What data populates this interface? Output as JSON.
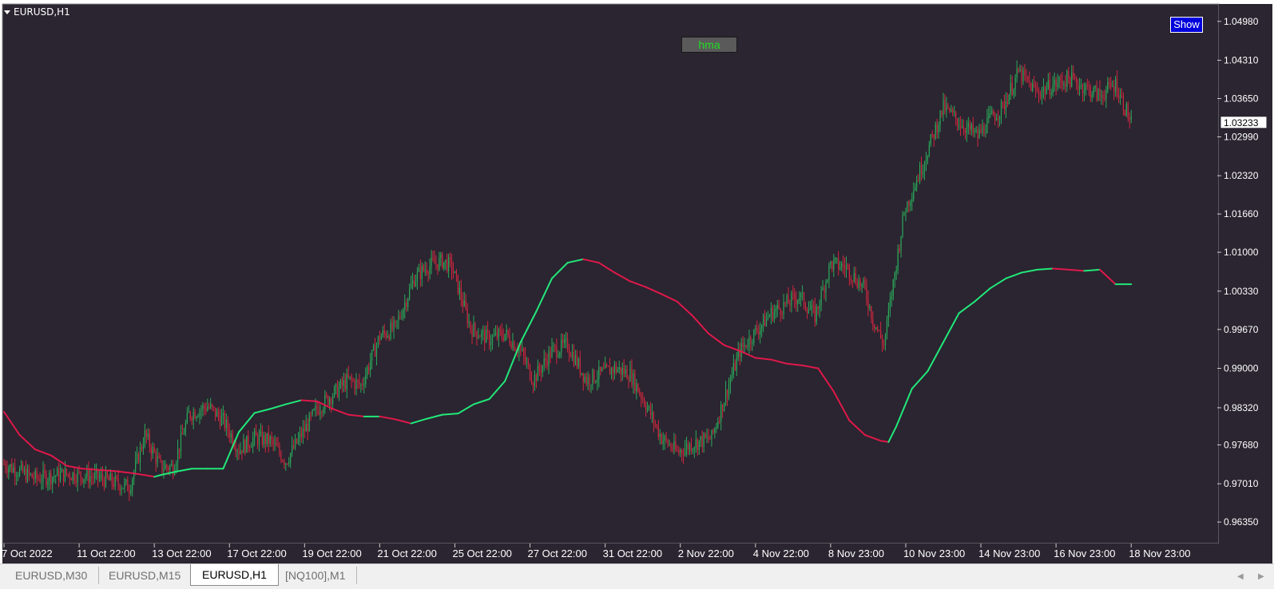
{
  "window": {
    "symbol_title": "EURUSD,H1",
    "hma_label": "hma",
    "show_button": "Show",
    "current_price": "1.03233"
  },
  "colors": {
    "background": "#2a2530",
    "bull_candle": "#2aa85a",
    "bear_candle": "#d0263f",
    "hma_up": "#22e87a",
    "hma_down": "#e0184a",
    "axis_text": "#ffffff",
    "hma_label_text": "#22dd22",
    "show_button_bg": "#0000dd"
  },
  "tabs": [
    {
      "label": "EURUSD,M30",
      "active": false
    },
    {
      "label": "EURUSD,M15",
      "active": false
    },
    {
      "label": "EURUSD,H1",
      "active": true
    },
    {
      "label": "[NQ100],M1",
      "active": false
    }
  ],
  "chart_data": {
    "type": "line",
    "title": "EURUSD,H1",
    "xlabel": "",
    "ylabel": "",
    "ylim": [
      0.9598,
      1.0528
    ],
    "y_ticks": [
      "1.04980",
      "1.04310",
      "1.03650",
      "1.02990",
      "1.02320",
      "1.01660",
      "1.01000",
      "1.00330",
      "0.99670",
      "0.99000",
      "0.98320",
      "0.97680",
      "0.97010",
      "0.96350"
    ],
    "x_ticks": [
      "7 Oct 2022",
      "11 Oct 22:00",
      "13 Oct 22:00",
      "17 Oct 22:00",
      "19 Oct 22:00",
      "21 Oct 22:00",
      "25 Oct 22:00",
      "27 Oct 22:00",
      "31 Oct 22:00",
      "2 Nov 22:00",
      "4 Nov 22:00",
      "8 Nov 23:00",
      "10 Nov 23:00",
      "14 Nov 23:00",
      "16 Nov 23:00",
      "18 Nov 23:00"
    ],
    "x_tick_positions": [
      0,
      48,
      96,
      144,
      192,
      240,
      288,
      336,
      384,
      432,
      480,
      528,
      576,
      624,
      672,
      720
    ],
    "x_range": [
      0,
      760
    ],
    "price_path": {
      "x": [
        0,
        20,
        40,
        60,
        80,
        90,
        100,
        108,
        118,
        130,
        140,
        150,
        160,
        170,
        180,
        200,
        220,
        228,
        240,
        250,
        262,
        270,
        280,
        286,
        298,
        310,
        320,
        330,
        338,
        350,
        360,
        372,
        390,
        400,
        410,
        420,
        430,
        440,
        452,
        470,
        490,
        508,
        518,
        528,
        538,
        550,
        555,
        562,
        575,
        588,
        600,
        612,
        622,
        630,
        638,
        648,
        660,
        680,
        700,
        710,
        720
      ],
      "y": [
        0.9735,
        0.971,
        0.9718,
        0.9712,
        0.9695,
        0.9785,
        0.973,
        0.973,
        0.982,
        0.9835,
        0.981,
        0.976,
        0.978,
        0.9775,
        0.974,
        0.983,
        0.988,
        0.987,
        0.9955,
        0.997,
        1.0055,
        1.0075,
        1.0085,
        1.0075,
        0.997,
        0.995,
        0.996,
        0.993,
        0.988,
        0.993,
        0.994,
        0.988,
        0.99,
        0.989,
        0.9838,
        0.978,
        0.9755,
        0.977,
        0.978,
        0.993,
        0.9995,
        1.0025,
        0.999,
        1.008,
        1.0075,
        1.0035,
        0.9985,
        0.994,
        1.017,
        1.026,
        1.035,
        1.032,
        1.03,
        1.033,
        1.035,
        1.041,
        1.0375,
        1.04,
        1.037,
        1.039,
        1.0323
      ]
    },
    "series": [
      {
        "x": [
          0,
          10,
          20,
          30,
          40,
          50,
          60,
          70,
          80,
          90,
          96,
          100,
          110,
          120,
          130,
          140,
          150,
          160,
          170,
          180,
          190,
          200,
          210,
          220,
          230,
          240,
          250,
          260,
          270,
          280,
          290,
          300,
          310,
          320,
          330,
          340,
          350,
          360,
          370,
          380,
          390,
          400,
          410,
          420,
          430,
          440,
          450,
          460,
          470,
          480,
          490,
          500,
          510,
          520,
          530,
          540,
          550,
          560,
          565,
          570,
          580,
          590,
          600,
          610,
          620,
          630,
          640,
          650,
          660,
          670,
          680,
          690,
          700,
          710,
          720
        ],
        "y": [
          0.9825,
          0.9785,
          0.976,
          0.975,
          0.9732,
          0.9727,
          0.9725,
          0.9723,
          0.972,
          0.9716,
          0.9713,
          0.9716,
          0.9722,
          0.9727,
          0.9727,
          0.9727,
          0.979,
          0.9823,
          0.983,
          0.9838,
          0.9845,
          0.9843,
          0.983,
          0.982,
          0.9817,
          0.9817,
          0.9812,
          0.9805,
          0.9813,
          0.982,
          0.9822,
          0.9838,
          0.9847,
          0.9878,
          0.9945,
          0.9998,
          1.0055,
          1.0082,
          1.0088,
          1.0082,
          1.0065,
          1.005,
          1.004,
          1.0028,
          1.0015,
          0.999,
          0.996,
          0.994,
          0.993,
          0.9918,
          0.9915,
          0.9908,
          0.9905,
          0.99,
          0.986,
          0.981,
          0.9785,
          0.9775,
          0.9773,
          0.98,
          0.9865,
          0.9895,
          0.9945,
          0.9995,
          1.0015,
          1.0038,
          1.0055,
          1.0065,
          1.007,
          1.0072,
          1.007,
          1.0068,
          1.007,
          1.0045,
          1.0045
        ]
      }
    ],
    "grid": false,
    "legend": "none"
  }
}
